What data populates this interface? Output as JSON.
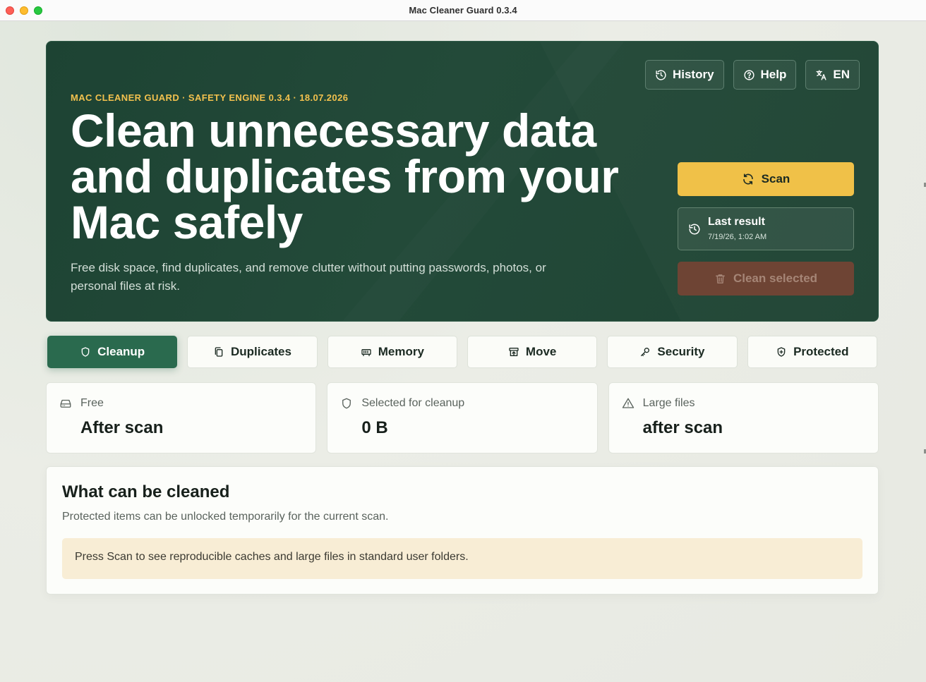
{
  "window": {
    "title": "Mac Cleaner Guard 0.3.4"
  },
  "hero": {
    "eyebrow": "MAC CLEANER GUARD · SAFETY ENGINE 0.3.4 · 18.07.2026",
    "headline": "Clean unnecessary data and duplicates from your Mac safely",
    "subtext": "Free disk space, find duplicates, and remove clutter without putting passwords, photos, or personal files at risk.",
    "top_actions": {
      "history": "History",
      "help": "Help",
      "language": "EN"
    },
    "scan_label": "Scan",
    "last_result": {
      "title": "Last result",
      "time": "7/19/26, 1:02 AM"
    },
    "clean_selected_label": "Clean selected"
  },
  "tabs": [
    {
      "label": "Cleanup",
      "icon": "shield-icon",
      "active": true
    },
    {
      "label": "Duplicates",
      "icon": "copy-icon",
      "active": false
    },
    {
      "label": "Memory",
      "icon": "memory-icon",
      "active": false
    },
    {
      "label": "Move",
      "icon": "archive-icon",
      "active": false
    },
    {
      "label": "Security",
      "icon": "key-icon",
      "active": false
    },
    {
      "label": "Protected",
      "icon": "shield-plus-icon",
      "active": false
    }
  ],
  "stats": [
    {
      "label": "Free",
      "value": "After scan",
      "icon": "drive-icon"
    },
    {
      "label": "Selected for cleanup",
      "value": "0 B",
      "icon": "shield-icon"
    },
    {
      "label": "Large files",
      "value": "after scan",
      "icon": "warning-icon"
    }
  ],
  "cleanable": {
    "title": "What can be cleaned",
    "subtitle": "Protected items can be unlocked temporarily for the current scan.",
    "notice": "Press Scan to see reproducible caches and large files in standard user folders."
  },
  "colors": {
    "hero_bg": "#1f4434",
    "accent_yellow": "#f0c148",
    "active_tab": "#2a6a4e",
    "danger_disabled": "#6e4434",
    "notice_bg": "#f8edd5"
  }
}
